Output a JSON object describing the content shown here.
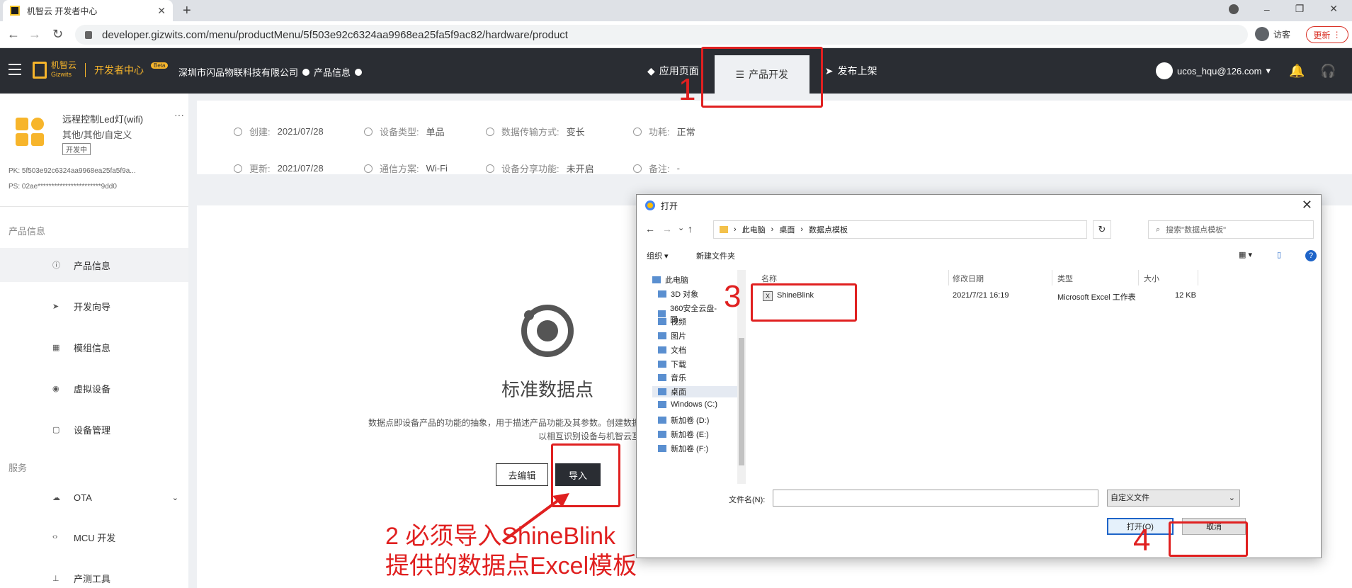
{
  "browser": {
    "tab_title": "机智云 开发者中心",
    "tab_close": "✕",
    "new_tab": "+",
    "back": "←",
    "forward": "→",
    "reload": "↻",
    "url": "developer.gizwits.com/menu/productMenu/5f503e92c6324aa9968ea25fa5f9ac82/hardware/product",
    "visitor_label": "访客",
    "update_label": "更新",
    "update_more": "⋮",
    "win_minimize": "–",
    "win_restore": "❐",
    "win_close": "✕"
  },
  "header": {
    "logo_text_cn": "机智云",
    "logo_text_en": "Gizwits",
    "dev_center": "开发者中心",
    "beta": "Beta",
    "company": "深圳市闪品物联科技有限公司",
    "product_info_link": "产品信息",
    "nav": [
      {
        "label": "应用页面",
        "icon": "◆"
      },
      {
        "label": "产品开发",
        "icon": "☰"
      },
      {
        "label": "发布上架",
        "icon": "➤"
      }
    ],
    "user_email": "ucos_hqu@126.com",
    "user_caret": "▾",
    "bell": "🔔",
    "headset": "🎧"
  },
  "product": {
    "name": "远程控制Led灯(wifi)",
    "category": "其他/其他/自定义",
    "status": "开发中",
    "more": "···",
    "pk": "PK:  5f503e92c6324aa9968ea25fa5f9a...",
    "ps": "PS:  02ae***********************9dd0"
  },
  "sidebar": {
    "section_product": "产品信息",
    "section_service": "服务",
    "items": [
      {
        "label": "产品信息",
        "icon": "ⓘ"
      },
      {
        "label": "开发向导",
        "icon": "➤"
      },
      {
        "label": "模组信息",
        "icon": "▦"
      },
      {
        "label": "虚拟设备",
        "icon": "◉"
      },
      {
        "label": "设备管理",
        "icon": "▢"
      },
      {
        "label": "OTA",
        "icon": "☁",
        "chevron": "⌄"
      },
      {
        "label": "MCU 开发",
        "icon": "‹›"
      },
      {
        "label": "产测工具",
        "icon": "⊥"
      }
    ]
  },
  "info": {
    "created_label": "创建:",
    "created": "2021/07/28",
    "updated_label": "更新:",
    "updated": "2021/07/28",
    "device_type_label": "设备类型:",
    "device_type": "单品",
    "comm_label": "通信方案:",
    "comm": "Wi-Fi",
    "transfer_label": "数据传输方式:",
    "transfer": "变长",
    "share_label": "设备分享功能:",
    "share": "未开启",
    "power_label": "功耗:",
    "power": "正常",
    "note_label": "备注:",
    "note": "-"
  },
  "datapoint": {
    "title": "标准数据点",
    "desc_line1": "数据点即设备产品的功能的抽象，用于描述产品功能及其参数。创建数据点后，设备与云",
    "desc_line2": "以相互识别设备与机智云互联互通的数据。",
    "edit_button": "去编辑",
    "import_button": "导入"
  },
  "annotations": {
    "n1": "1",
    "n2_line1": "2 必须导入ShineBlink",
    "n2_line2": "提供的数据点Excel模板",
    "n3": "3",
    "n4": "4",
    "color": "#e02020"
  },
  "dialog": {
    "title": "打开",
    "close": "✕",
    "nav_back": "←",
    "nav_forward": "→",
    "nav_down": "⌄",
    "nav_up": "↑",
    "crumbs": [
      "此电脑",
      "桌面",
      "数据点模板"
    ],
    "refresh": "↻",
    "search_placeholder": "搜索\"数据点模板\"",
    "organize": "组织 ▾",
    "new_folder": "新建文件夹",
    "view": "▦ ▾",
    "preview": "▯",
    "help": "?",
    "tree": [
      "此电脑",
      "3D 对象",
      "360安全云盘-同",
      "视频",
      "图片",
      "文档",
      "下载",
      "音乐",
      "桌面",
      "Windows (C:)",
      "新加卷 (D:)",
      "新加卷 (E:)",
      "新加卷 (F:)"
    ],
    "columns": {
      "name": "名称",
      "date": "修改日期",
      "type": "类型",
      "size": "大小"
    },
    "file": {
      "name": "ShineBlink",
      "date": "2021/7/21 16:19",
      "type": "Microsoft Excel 工作表",
      "size": "12 KB"
    },
    "filename_label": "文件名(N):",
    "filetype": "自定义文件",
    "open_button": "打开(O)",
    "cancel_button": "取消"
  }
}
